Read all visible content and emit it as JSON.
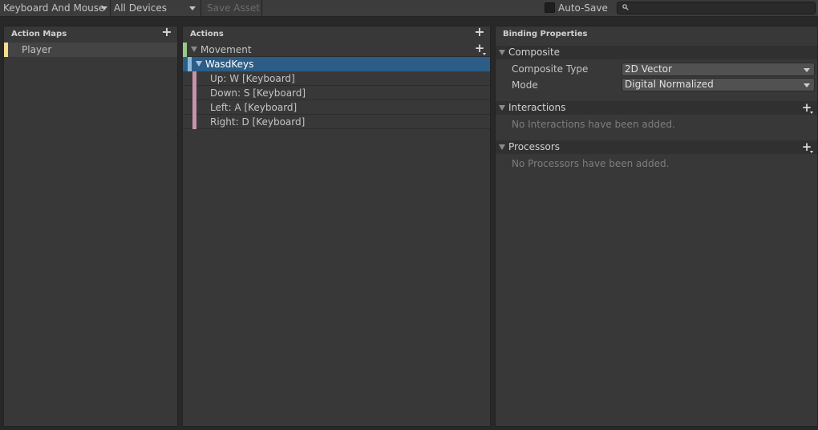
{
  "toolbar": {
    "control_scheme": "Keyboard And Mouse",
    "devices": "All Devices",
    "save_asset": "Save Asset",
    "auto_save": "Auto-Save",
    "search_value": ""
  },
  "action_maps": {
    "title": "Action Maps",
    "items": [
      {
        "label": "Player",
        "color": "#f2de8c"
      }
    ]
  },
  "actions": {
    "title": "Actions",
    "action": {
      "label": "Movement",
      "color": "#9ac88c"
    },
    "composite": {
      "label": "WasdKeys",
      "color": "#8fb8d8"
    },
    "bindings": [
      {
        "label": "Up: W [Keyboard]",
        "color": "#c892a8"
      },
      {
        "label": "Down: S [Keyboard]",
        "color": "#c892a8"
      },
      {
        "label": "Left: A [Keyboard]",
        "color": "#c892a8"
      },
      {
        "label": "Right: D [Keyboard]",
        "color": "#c892a8"
      }
    ]
  },
  "binding_properties": {
    "title": "Binding Properties",
    "composite": {
      "header": "Composite",
      "type_label": "Composite Type",
      "type_value": "2D Vector",
      "mode_label": "Mode",
      "mode_value": "Digital Normalized"
    },
    "interactions": {
      "header": "Interactions",
      "empty": "No Interactions have been added."
    },
    "processors": {
      "header": "Processors",
      "empty": "No Processors have been added."
    }
  },
  "colors": {
    "selection": "#2c5d87",
    "panel": "#383838",
    "toolbar": "#3c3c3c"
  }
}
